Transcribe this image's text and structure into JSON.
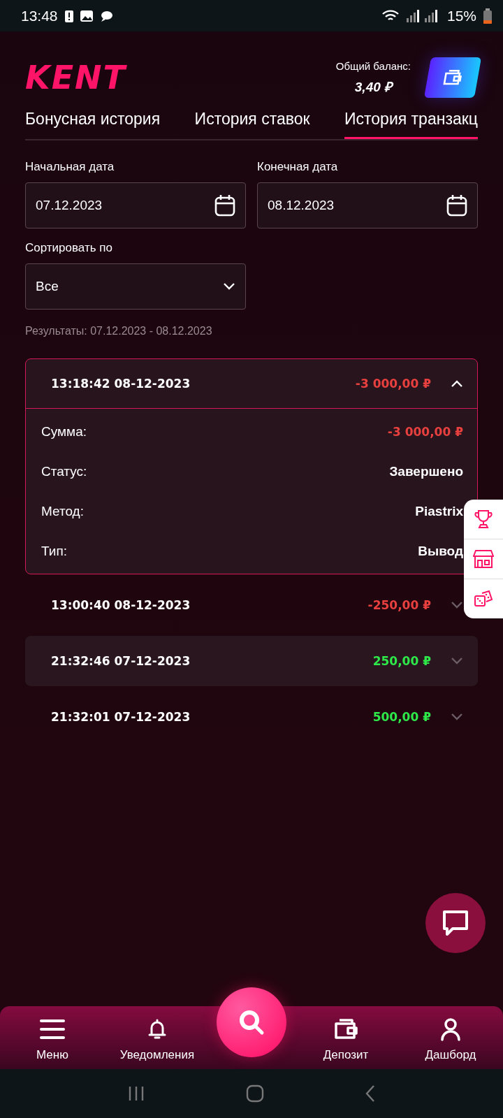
{
  "status_bar": {
    "time": "13:48",
    "battery": "15%"
  },
  "header": {
    "logo": "KENT",
    "balance_label": "Общий баланс:",
    "balance": "3,40 ₽"
  },
  "tabs": [
    {
      "label": "Бонусная история",
      "selected": false
    },
    {
      "label": "История ставок",
      "selected": false
    },
    {
      "label": "История транзакц",
      "selected": true
    }
  ],
  "filters": {
    "start": {
      "label": "Начальная дата",
      "value": "07.12.2023"
    },
    "end": {
      "label": "Конечная дата",
      "value": "08.12.2023"
    },
    "sort": {
      "label": "Сортировать по",
      "value": "Все"
    }
  },
  "results": "Результаты: 07.12.2023 - 08.12.2023",
  "transactions": [
    {
      "time": "13:18:42 08-12-2023",
      "amount": "-3 000,00 ₽",
      "kind": "debit",
      "expanded": true,
      "selected": false,
      "details": [
        {
          "label": "Сумма:",
          "value": "-3 000,00 ₽",
          "kind": "debit"
        },
        {
          "label": "Статус:",
          "value": "Завершено",
          "kind": "plain"
        },
        {
          "label": "Метод:",
          "value": "Piastrix",
          "kind": "plain"
        },
        {
          "label": "Тип:",
          "value": "Вывод",
          "kind": "plain"
        }
      ]
    },
    {
      "time": "13:00:40 08-12-2023",
      "amount": "-250,00 ₽",
      "kind": "debit",
      "expanded": false,
      "selected": false
    },
    {
      "time": "21:32:46 07-12-2023",
      "amount": "250,00 ₽",
      "kind": "credit",
      "expanded": false,
      "selected": true
    },
    {
      "time": "21:32:01 07-12-2023",
      "amount": "500,00 ₽",
      "kind": "credit",
      "expanded": false,
      "selected": false
    }
  ],
  "nav": [
    {
      "label": "Меню",
      "kind": "menu"
    },
    {
      "label": "Уведомления",
      "kind": "bell"
    },
    {
      "kind": "search"
    },
    {
      "label": "Депозит",
      "kind": "wallet"
    },
    {
      "label": "Дашборд",
      "kind": "user"
    }
  ]
}
